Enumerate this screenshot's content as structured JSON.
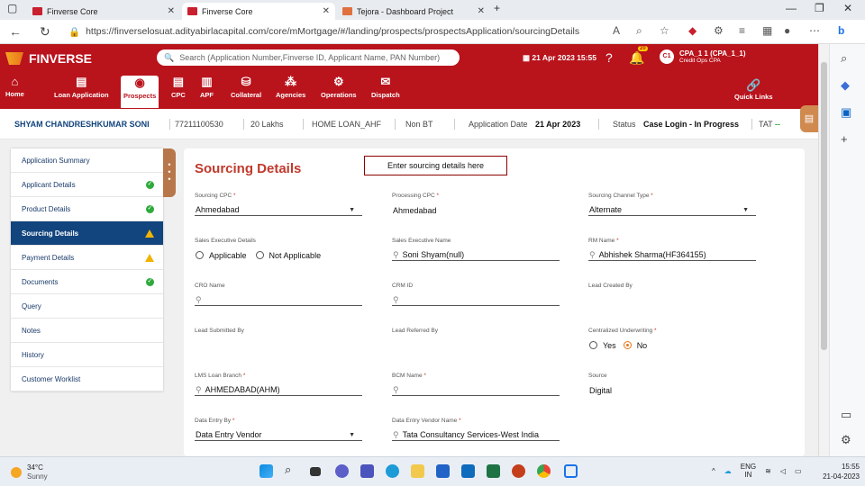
{
  "browser": {
    "tabs": [
      {
        "title": "Finverse Core",
        "active": false
      },
      {
        "title": "Finverse Core",
        "active": true
      },
      {
        "title": "Tejora - Dashboard Project",
        "active": false
      }
    ],
    "url": "https://finverselosuat.adityabirlacapital.com/core/mMortgage/#/landing/prospects/prospectsApplication/sourcingDetails"
  },
  "app": {
    "name": "FINVERSE",
    "search_placeholder": "Search (Application Number,Finverse ID, Applicant Name, PAN Number)",
    "datetime": "21 Apr 2023 15:55",
    "notif_count": "20",
    "user_initials": "C1",
    "user_name": "CPA_1 1 (CPA_1_1)",
    "user_role": "Credit Ops CPA",
    "nav": [
      "Home",
      "Loan Application",
      "Prospects",
      "CPC",
      "APF",
      "Collateral",
      "Agencies",
      "Operations",
      "Dispatch"
    ],
    "quick_links": "Quick Links"
  },
  "applicant": {
    "name": "SHYAM CHANDRESHKUMAR SONI",
    "id": "77211100530",
    "amount": "20 Lakhs",
    "product": "HOME LOAN_AHF",
    "bt": "Non BT",
    "app_date_label": "Application Date",
    "app_date": "21 Apr 2023",
    "status_label": "Status",
    "status": "Case Login - In Progress",
    "tat_label": "TAT",
    "tat": "--"
  },
  "sidebar": {
    "items": [
      {
        "label": "Application Summary",
        "status": ""
      },
      {
        "label": "Applicant Details",
        "status": "ok"
      },
      {
        "label": "Product Details",
        "status": "ok"
      },
      {
        "label": "Sourcing Details",
        "status": "warn"
      },
      {
        "label": "Payment Details",
        "status": "warn"
      },
      {
        "label": "Documents",
        "status": "ok"
      },
      {
        "label": "Query",
        "status": ""
      },
      {
        "label": "Notes",
        "status": ""
      },
      {
        "label": "History",
        "status": ""
      },
      {
        "label": "Customer Worklist",
        "status": ""
      }
    ]
  },
  "form": {
    "title": "Sourcing Details",
    "note": "Enter sourcing details here",
    "sourcing_cpc": {
      "label": "Sourcing CPC",
      "value": "Ahmedabad"
    },
    "processing_cpc": {
      "label": "Processing CPC",
      "value": "Ahmedabad"
    },
    "sourcing_channel": {
      "label": "Sourcing Channel Type",
      "value": "Alternate"
    },
    "sales_exec_details": {
      "label": "Sales Executive Details",
      "opt1": "Applicable",
      "opt2": "Not Applicable"
    },
    "sales_exec_name": {
      "label": "Sales Executive Name",
      "value": "Soni Shyam(null)"
    },
    "rm_name": {
      "label": "RM Name",
      "value": "Abhishek Sharma(HF364155)"
    },
    "cro_name": {
      "label": "CRO Name",
      "value": ""
    },
    "crm_id": {
      "label": "CRM ID",
      "value": ""
    },
    "lead_created_by": {
      "label": "Lead Created By",
      "value": ""
    },
    "lead_submitted_by": {
      "label": "Lead Submitted By",
      "value": ""
    },
    "lead_referred_by": {
      "label": "Lead Referred By",
      "value": ""
    },
    "centralized_uw": {
      "label": "Centralized Underwriting",
      "opt1": "Yes",
      "opt2": "No"
    },
    "lms_branch": {
      "label": "LMS Loan Branch",
      "value": "AHMEDABAD(AHM)"
    },
    "bcm_name": {
      "label": "BCM Name",
      "value": ""
    },
    "source": {
      "label": "Source",
      "value": "Digital"
    },
    "data_entry_by": {
      "label": "Data Entry By",
      "value": "Data Entry Vendor"
    },
    "data_entry_vendor": {
      "label": "Data Entry Vendor Name",
      "value": "Tata Consultancy Services-West India"
    }
  },
  "taskbar": {
    "temp": "34°C",
    "weather": "Sunny",
    "lang1": "ENG",
    "lang2": "IN",
    "time": "15:55",
    "date": "21-04-2023"
  }
}
